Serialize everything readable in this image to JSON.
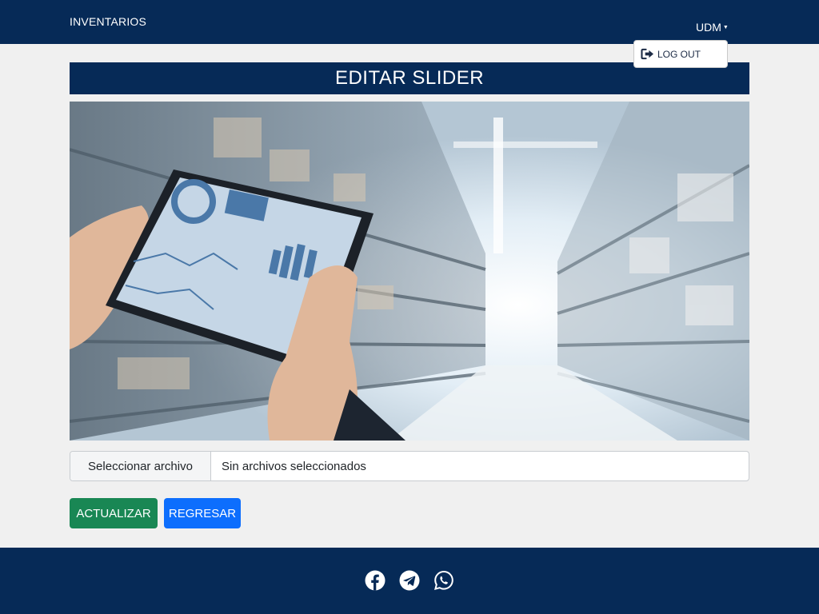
{
  "navbar": {
    "brand": "INVENTARIOS",
    "user_menu_label": "UDM",
    "dropdown": {
      "logout_label": "LOG OUT"
    }
  },
  "page": {
    "title": "EDITAR SLIDER",
    "image_alt": "warehouse-tablet-slider-image"
  },
  "file_input": {
    "button_label": "Seleccionar archivo",
    "status_text": "Sin archivos seleccionados"
  },
  "actions": {
    "update_label": "ACTUALIZAR",
    "back_label": "REGRESAR"
  },
  "footer": {
    "social_icons": [
      "facebook-icon",
      "telegram-icon",
      "whatsapp-icon"
    ]
  },
  "colors": {
    "navy": "#062a57",
    "update_green": "#198754",
    "back_blue": "#0d6efd",
    "background": "#f0f0f0"
  }
}
